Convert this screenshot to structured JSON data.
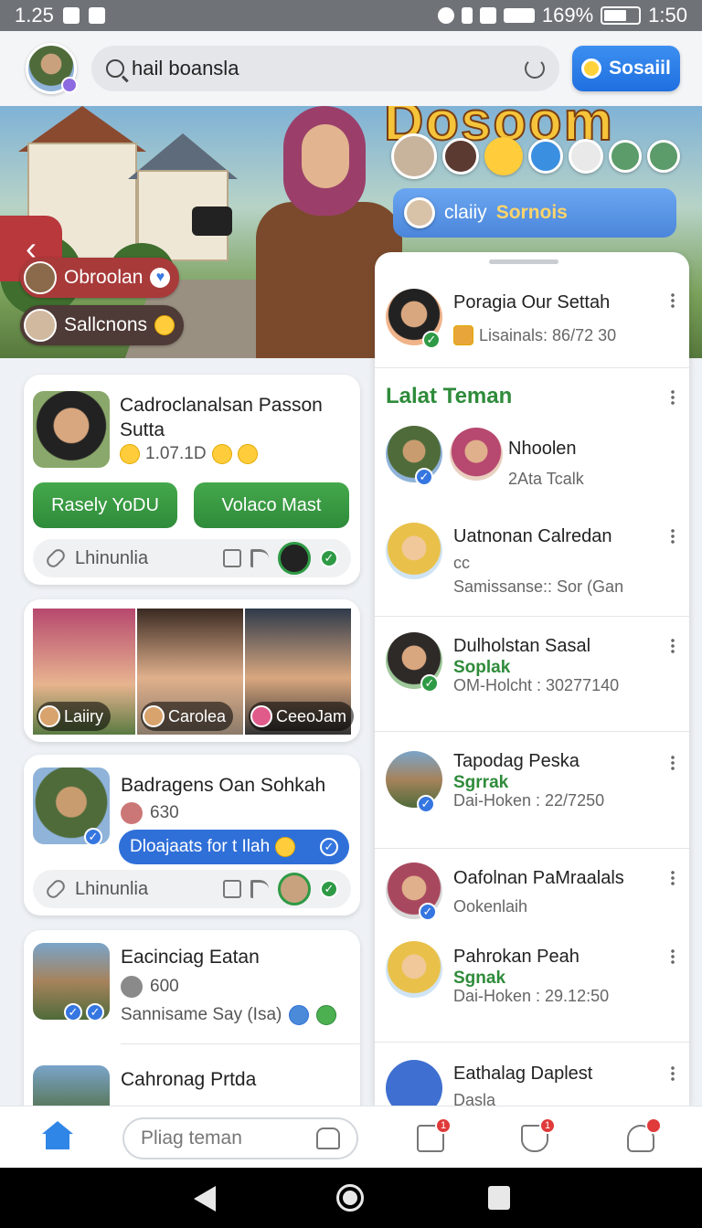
{
  "status_bar": {
    "time": "1.25",
    "battery": "169%",
    "clock": "1:50"
  },
  "header": {
    "search_value": "hail boansla",
    "action_label": "Sosaiil"
  },
  "hero": {
    "title": "Dosoom",
    "chip_name": "claiiy",
    "chip_accent": "Sornois",
    "pill_1": "Obroolan",
    "pill_2": "Sallcnons"
  },
  "left_cards": {
    "card1": {
      "title": "Cadroclanalsan Passon Sutta",
      "count": "1.07.1D",
      "button_1": "Rasely YoDU",
      "button_2": "Volaco Mast",
      "link_label": "Lhinunlia"
    },
    "photos": [
      {
        "caption": "Laiiry"
      },
      {
        "caption": "Carolea"
      },
      {
        "caption": "CeeoJam"
      }
    ],
    "card3": {
      "title": "Badragens Oan Sohkah",
      "count": "630",
      "bar_label": "Dloajaats for t Ilah",
      "link_label": "Lhinunlia"
    },
    "card4": {
      "title": "Eacinciag Eatan",
      "count": "600",
      "sub": "Sannisame Say (Isa)"
    },
    "card5": {
      "title": "Cahronag Prtda"
    }
  },
  "right_panel": {
    "top_item": {
      "name": "Poragia Our Settah",
      "sub": "Lisainals: 86/72 30"
    },
    "section_title": "Lalat Teman",
    "items": [
      {
        "name": "Nhoolen",
        "sub": "2Ata Tcalk"
      },
      {
        "name": "Uatnonan Calredan",
        "line2": "cc",
        "sub": "Samissanse:: Sor (Gan"
      },
      {
        "name": "Dulholstan Sasal",
        "green": "Soplak",
        "sub": "OM-Holcht : 30277140"
      },
      {
        "name": "Tapodag Peska",
        "green": "Sgrrak",
        "sub": "Dai-Hoken : 22/7250"
      },
      {
        "name": "Oafolnan PaMraalals",
        "sub": "Ookenlaih"
      },
      {
        "name": "Pahrokan Peah",
        "green": "Sgnak",
        "sub": "Dai-Hoken : 29.12:50"
      },
      {
        "name": "Eathalag Daplest",
        "sub": "Dasla"
      }
    ]
  },
  "bottom_nav": {
    "search_placeholder": "Pliag teman",
    "badges": {
      "messages": "1",
      "notifications": "1"
    }
  }
}
